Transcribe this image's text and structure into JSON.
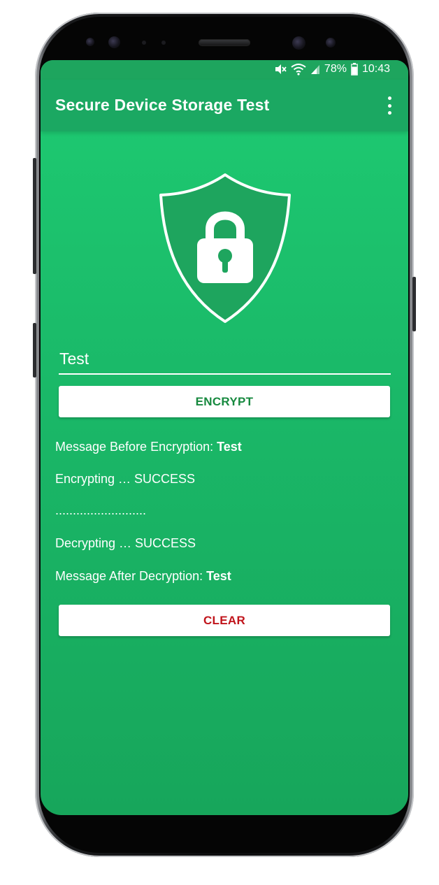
{
  "status_bar": {
    "battery": "78%",
    "time": "10:43",
    "icons": [
      "mute-icon",
      "wifi-icon",
      "signal-icon",
      "battery-icon"
    ]
  },
  "app_bar": {
    "title": "Secure Device Storage Test",
    "menu_icon": "more-vert-icon"
  },
  "hero": {
    "icon": "shield-lock-icon"
  },
  "form": {
    "input_value": "Test",
    "encrypt_label": "ENCRYPT",
    "clear_label": "CLEAR"
  },
  "log": {
    "before_label": "Message Before Encryption: ",
    "before_value": "Test",
    "encrypting": "Encrypting … SUCCESS",
    "separator": "..........................",
    "decrypting": "Decrypting … SUCCESS",
    "after_label": "Message After Decryption: ",
    "after_value": "Test"
  },
  "colors": {
    "screen_green": "#1ecb72",
    "app_bar_green": "#1ba862",
    "encrypt_text": "#17893f",
    "clear_text": "#c0141b"
  }
}
